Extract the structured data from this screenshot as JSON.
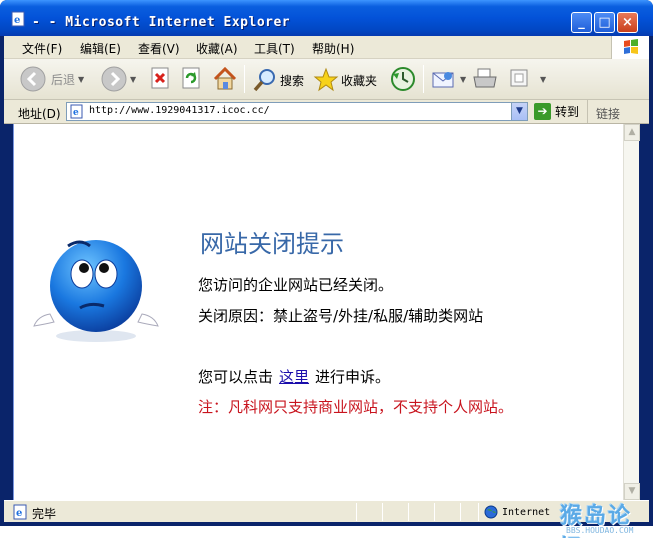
{
  "window": {
    "title": "- - Microsoft Internet Explorer",
    "min_glyph": "_",
    "max_glyph": "□",
    "close_glyph": "×"
  },
  "menubar": {
    "items": [
      "文件(F)",
      "编辑(E)",
      "查看(V)",
      "收藏(A)",
      "工具(T)",
      "帮助(H)"
    ]
  },
  "toolbar": {
    "back_label": "后退",
    "search_label": "搜索",
    "favorites_label": "收藏夹"
  },
  "addressbar": {
    "label": "地址(D)",
    "url": "http://www.1929041317.icoc.cc/",
    "go_label": "转到",
    "links_label": "链接"
  },
  "page": {
    "title": "网站关闭提示",
    "line1": "您访问的企业网站已经关闭。",
    "line2": "关闭原因：禁止盗号/外挂/私服/辅助类网站",
    "appeal_prefix": "您可以点击",
    "appeal_link": "这里",
    "appeal_suffix": "进行申诉。",
    "note": "注：凡科网只支持商业网站，不支持个人网站。"
  },
  "statusbar": {
    "text": "完毕",
    "zone": "Internet"
  },
  "watermark": {
    "text": "猴岛论坛",
    "sub": "BBS.HOUDAO.COM"
  },
  "colors": {
    "title_blue": "#3868a8",
    "note_red": "#c8141e",
    "link_blue": "#1a0dab"
  }
}
